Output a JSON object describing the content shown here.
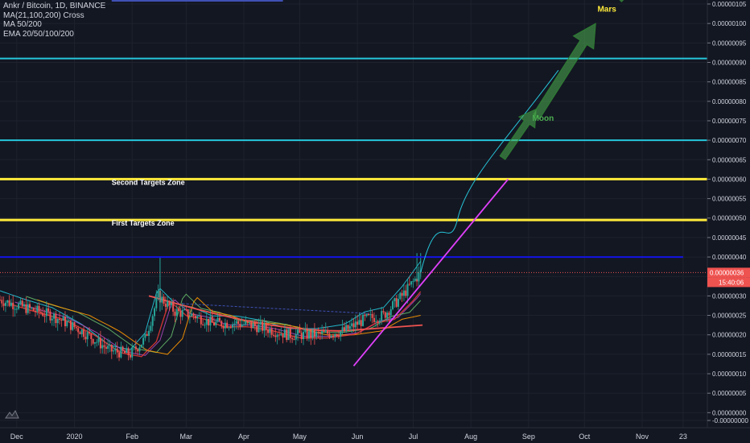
{
  "legend": {
    "symbol": "Ankr / Bitcoin, 1D, BINANCE",
    "ind1": "MA(21,100,200) Cross",
    "ind2": "MA 50/200",
    "ind3": "EMA 20/50/100/200"
  },
  "price_tag": {
    "value": "0.00000036",
    "time": "15:40:06"
  },
  "colors": {
    "up": "#26a69a",
    "down": "#ef5350",
    "cyan": "#26c6da",
    "yellow": "#ffeb3b",
    "blue": "#1414e6",
    "magenta": "#e040fb",
    "green": "#4caf50"
  },
  "chart_data": {
    "type": "candlestick",
    "y_axis": {
      "min": -2e-08,
      "max": 1.05e-06,
      "ticks": [
        "0.00000105",
        "0.00000100",
        "0.00000095",
        "0.00000090",
        "0.00000085",
        "0.00000080",
        "0.00000075",
        "0.00000070",
        "0.00000065",
        "0.00000060",
        "0.00000055",
        "0.00000050",
        "0.00000045",
        "0.00000040",
        "0.00000035",
        "0.00000030",
        "0.00000025",
        "0.00000020",
        "0.00000015",
        "0.00000010",
        "0.00000005",
        "0.00000000",
        "-0.00000000"
      ],
      "tick_values": [
        1.05,
        1.0,
        0.95,
        0.9,
        0.85,
        0.8,
        0.75,
        0.7,
        0.65,
        0.6,
        0.55,
        0.5,
        0.45,
        0.4,
        0.35,
        0.3,
        0.25,
        0.2,
        0.15,
        0.1,
        0.05,
        0.0,
        -0.02
      ],
      "unit_scale": "1e-6"
    },
    "x_axis": {
      "start": "2019-11-22",
      "end": "2020-12-03",
      "labels": [
        {
          "text": "Dec",
          "date": "2019-12-01"
        },
        {
          "text": "2020",
          "date": "2020-01-01"
        },
        {
          "text": "Feb",
          "date": "2020-02-01"
        },
        {
          "text": "Mar",
          "date": "2020-03-01"
        },
        {
          "text": "Apr",
          "date": "2020-04-01"
        },
        {
          "text": "May",
          "date": "2020-05-01"
        },
        {
          "text": "Jun",
          "date": "2020-06-01"
        },
        {
          "text": "Jul",
          "date": "2020-07-01"
        },
        {
          "text": "Aug",
          "date": "2020-08-01"
        },
        {
          "text": "Sep",
          "date": "2020-09-01"
        },
        {
          "text": "Oct",
          "date": "2020-10-01"
        },
        {
          "text": "Nov",
          "date": "2020-11-01"
        },
        {
          "text": "23",
          "date": "2020-11-23"
        }
      ]
    },
    "price_path": [
      {
        "date": "2019-11-22",
        "close": 0.29
      },
      {
        "date": "2019-12-05",
        "close": 0.27
      },
      {
        "date": "2019-12-20",
        "close": 0.25
      },
      {
        "date": "2020-01-05",
        "close": 0.21
      },
      {
        "date": "2020-01-20",
        "close": 0.16
      },
      {
        "date": "2020-01-31",
        "close": 0.15
      },
      {
        "date": "2020-02-08",
        "close": 0.19
      },
      {
        "date": "2020-02-15",
        "close": 0.3
      },
      {
        "date": "2020-02-24",
        "close": 0.26
      },
      {
        "date": "2020-03-05",
        "close": 0.25
      },
      {
        "date": "2020-03-15",
        "close": 0.23
      },
      {
        "date": "2020-03-28",
        "close": 0.23
      },
      {
        "date": "2020-04-10",
        "close": 0.22
      },
      {
        "date": "2020-04-25",
        "close": 0.2
      },
      {
        "date": "2020-05-10",
        "close": 0.2
      },
      {
        "date": "2020-05-25",
        "close": 0.21
      },
      {
        "date": "2020-06-05",
        "close": 0.24
      },
      {
        "date": "2020-06-15",
        "close": 0.25
      },
      {
        "date": "2020-06-25",
        "close": 0.3
      },
      {
        "date": "2020-07-05",
        "close": 0.36
      }
    ],
    "horizontal_levels": [
      {
        "value": 0.91,
        "color": "cyan"
      },
      {
        "value": 0.7,
        "color": "cyan"
      },
      {
        "value": 0.6,
        "color": "yellow",
        "label": "Second Targets Zone"
      },
      {
        "value": 0.495,
        "color": "yellow",
        "label": "First Targets Zone"
      },
      {
        "value": 0.4,
        "color": "blue"
      },
      {
        "value": 0.36,
        "color": "red-dotted"
      }
    ],
    "annotations": [
      {
        "text": "Moon",
        "date": "2020-09-03",
        "value": 0.75
      },
      {
        "text": "Mars",
        "date": "2020-10-08",
        "value": 1.03
      }
    ]
  }
}
